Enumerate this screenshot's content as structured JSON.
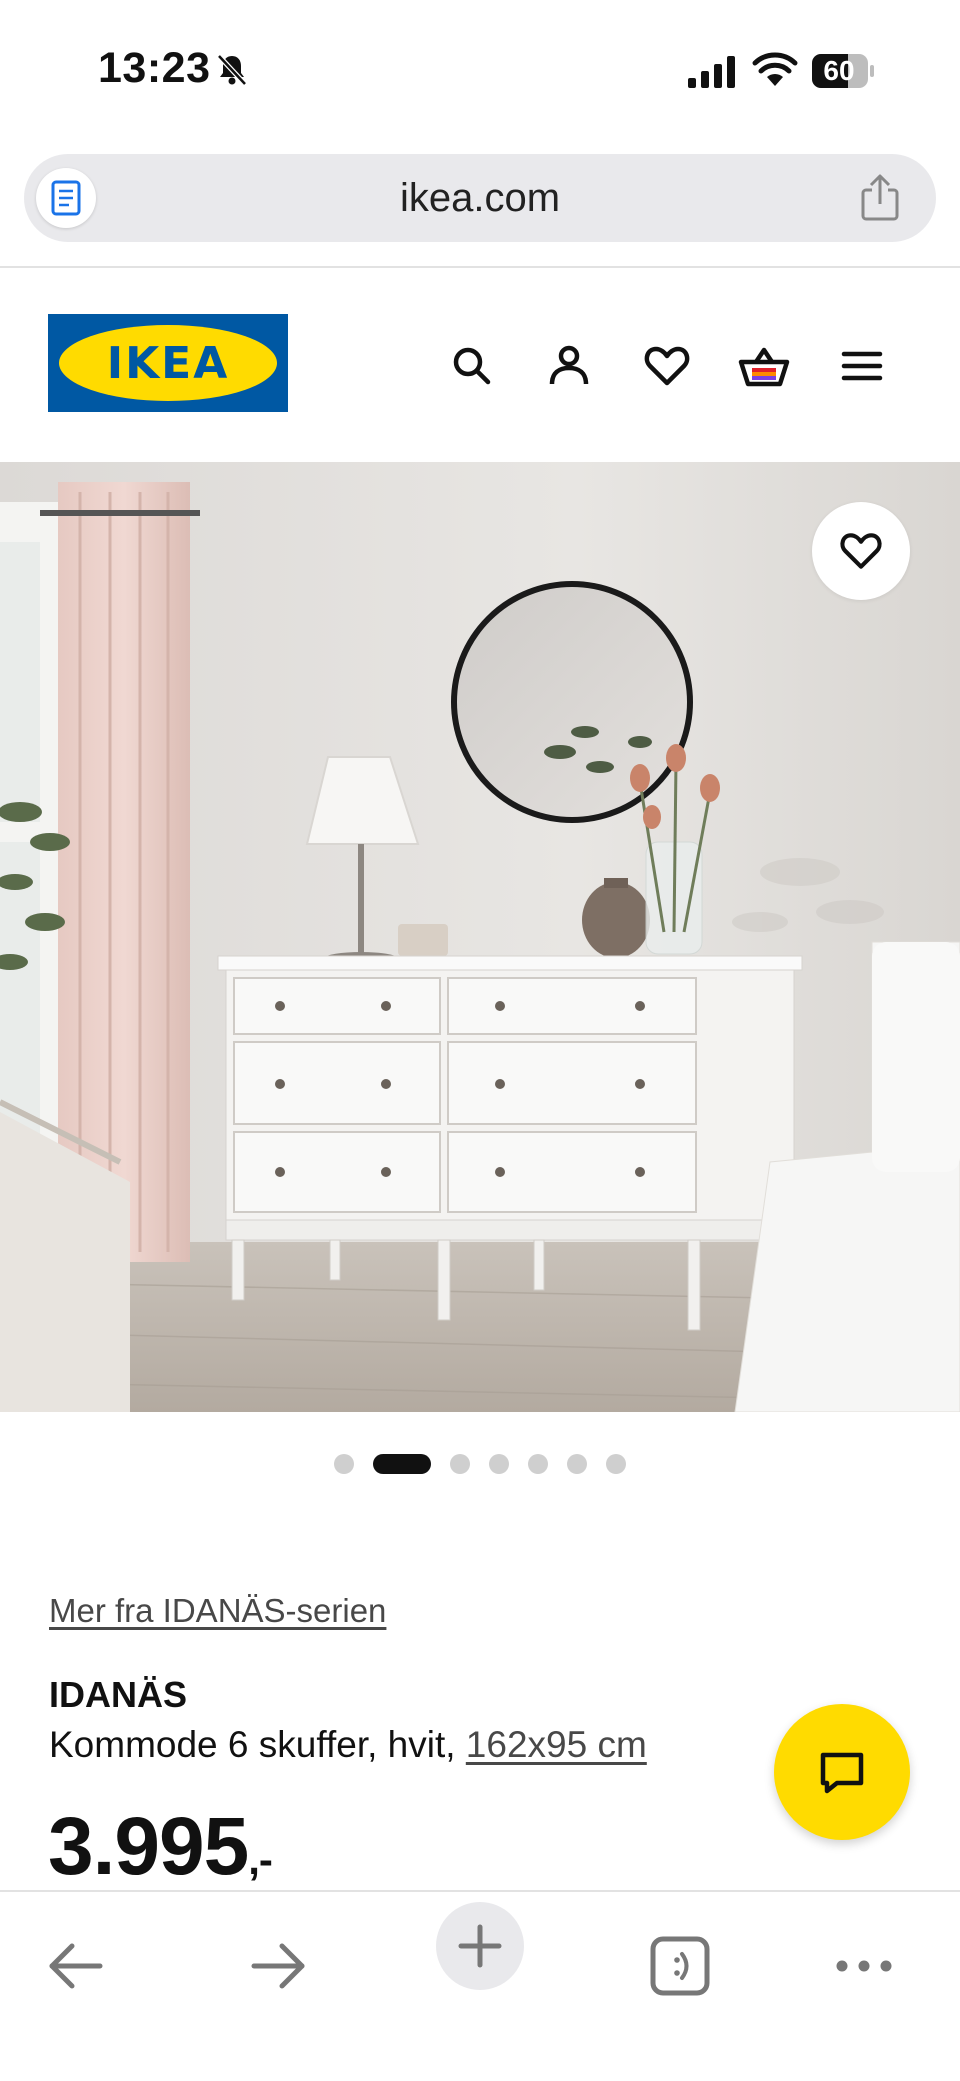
{
  "status_bar": {
    "time": "13:23",
    "battery": "60"
  },
  "browser": {
    "url": "ikea.com"
  },
  "icons": {
    "reader": "reader-icon",
    "share": "share-icon",
    "search": "search-icon",
    "account": "person-icon",
    "wishlist": "heart-icon",
    "cart": "basket-icon",
    "menu": "hamburger-icon",
    "chat": "chat-icon"
  },
  "colors": {
    "brand_blue": "#0058a3",
    "brand_yellow": "#ffdb00"
  },
  "header": {
    "logo_text": "IKEA"
  },
  "gallery": {
    "image_count": 7,
    "active_index": 1
  },
  "product": {
    "series_link": "Mer fra IDANÄS-serien",
    "name": "IDANÄS",
    "description": "Kommode 6 skuffer, hvit,",
    "dimensions": "162x95 cm",
    "price": "3.995",
    "price_suffix": ",-"
  }
}
